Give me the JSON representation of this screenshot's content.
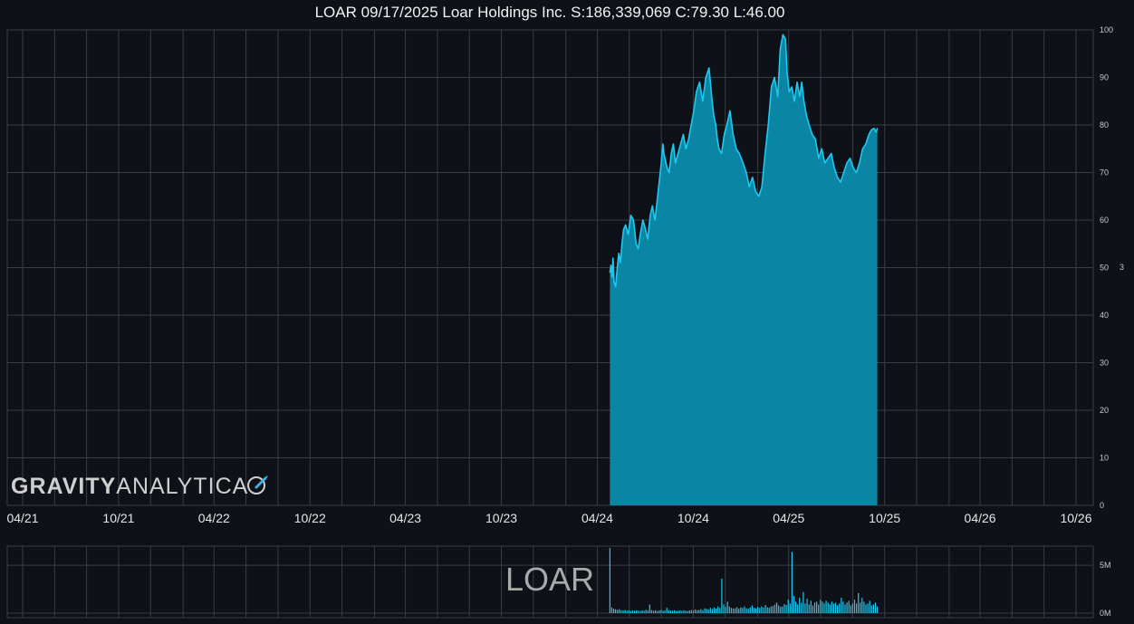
{
  "title": "LOAR 09/17/2025 Loar Holdings Inc. S:186,339,069 C:79.30 L:46.00",
  "logo": {
    "bold": "GRAVITY",
    "light": "ANALYTICA",
    "icon": "rocket-icon"
  },
  "ticker_watermark": "LOAR",
  "y_tag": "3",
  "colors": {
    "background": "#0e1117",
    "grid": "#3a3d44",
    "line": "#1fc8ef",
    "fill": "#0a8fb0"
  },
  "chart_data": [
    {
      "type": "area",
      "title": "LOAR 09/17/2025 Loar Holdings Inc. S:186,339,069 C:79.30 L:46.00",
      "x_tick_labels": [
        "04/21",
        "10/21",
        "04/22",
        "10/22",
        "04/23",
        "10/23",
        "04/24",
        "10/24",
        "04/25",
        "10/25",
        "04/26",
        "10/26"
      ],
      "y_ticks": [
        0,
        10,
        20,
        30,
        40,
        50,
        60,
        70,
        80,
        90,
        100
      ],
      "ylim": [
        0,
        100
      ],
      "grid": true,
      "y_axis_side": "right",
      "x": [
        "2024-04-25",
        "2024-04-27",
        "2024-04-29",
        "2024-05-01",
        "2024-05-03",
        "2024-05-06",
        "2024-05-09",
        "2024-05-12",
        "2024-05-15",
        "2024-05-18",
        "2024-05-21",
        "2024-05-25",
        "2024-05-30",
        "2024-06-04",
        "2024-06-09",
        "2024-06-14",
        "2024-06-18",
        "2024-06-22",
        "2024-06-27",
        "2024-07-02",
        "2024-07-06",
        "2024-07-11",
        "2024-07-15",
        "2024-07-20",
        "2024-07-24",
        "2024-07-28",
        "2024-08-01",
        "2024-08-04",
        "2024-08-06",
        "2024-08-08",
        "2024-08-12",
        "2024-08-16",
        "2024-08-20",
        "2024-08-24",
        "2024-08-28",
        "2024-09-02",
        "2024-09-07",
        "2024-09-12",
        "2024-09-17",
        "2024-09-22",
        "2024-09-27",
        "2024-10-02",
        "2024-10-07",
        "2024-10-13",
        "2024-10-19",
        "2024-10-25",
        "2024-10-31",
        "2024-11-05",
        "2024-11-09",
        "2024-11-13",
        "2024-11-16",
        "2024-11-19",
        "2024-11-24",
        "2024-11-29",
        "2024-12-04",
        "2024-12-10",
        "2024-12-16",
        "2024-12-22",
        "2024-12-28",
        "2025-01-04",
        "2025-01-10",
        "2025-01-16",
        "2025-01-22",
        "2025-01-28",
        "2025-02-03",
        "2025-02-09",
        "2025-02-15",
        "2025-02-21",
        "2025-02-27",
        "2025-03-05",
        "2025-03-11",
        "2025-03-16",
        "2025-03-21",
        "2025-03-26",
        "2025-03-29",
        "2025-04-02",
        "2025-04-07",
        "2025-04-12",
        "2025-04-17",
        "2025-04-22",
        "2025-04-26",
        "2025-04-30",
        "2025-05-05",
        "2025-05-10",
        "2025-05-16",
        "2025-05-22",
        "2025-05-28",
        "2025-06-03",
        "2025-06-09",
        "2025-06-15",
        "2025-06-21",
        "2025-06-27",
        "2025-07-03",
        "2025-07-09",
        "2025-07-15",
        "2025-07-21",
        "2025-07-27",
        "2025-08-02",
        "2025-08-08",
        "2025-08-14",
        "2025-08-20",
        "2025-08-26",
        "2025-09-01",
        "2025-09-06",
        "2025-09-11",
        "2025-09-15",
        "2025-09-17"
      ],
      "series": [
        {
          "values": [
            49,
            50.5,
            48,
            52,
            47,
            46,
            50,
            53,
            51,
            55,
            58,
            59,
            57,
            61,
            60,
            55,
            54,
            57,
            60,
            58,
            56,
            61,
            63,
            60,
            64,
            68,
            72,
            76,
            74,
            73,
            71,
            70,
            74,
            76,
            72,
            74,
            76,
            78,
            75,
            77,
            80,
            83,
            87,
            89,
            85,
            90,
            92,
            86,
            82,
            80,
            77,
            75,
            74,
            78,
            80,
            83,
            78,
            75,
            74,
            72,
            70,
            67,
            69,
            66,
            65,
            67,
            74,
            80,
            88,
            90,
            86,
            96,
            99,
            98,
            91,
            87,
            88,
            85,
            89,
            86,
            89,
            85,
            82,
            80,
            78,
            77,
            73,
            75,
            72,
            73,
            74,
            71,
            69,
            68,
            70,
            72,
            73,
            71,
            70,
            72,
            75,
            76,
            78,
            79,
            79.3,
            78.5,
            79.3
          ]
        }
      ]
    },
    {
      "type": "bar",
      "title": "LOAR",
      "y_tick_labels": [
        "0M",
        "5M"
      ],
      "ylim": [
        0,
        7
      ],
      "grid": true,
      "y_axis_side": "right",
      "x_range": [
        "2024-04-25",
        "2025-09-17"
      ],
      "series": [
        {
          "values": [
            6.8,
            0.6,
            0.45,
            0.4,
            0.35,
            0.42,
            0.3,
            0.28,
            0.34,
            0.25,
            0.3,
            0.22,
            0.28,
            0.24,
            0.3,
            0.26,
            0.22,
            0.3,
            0.25,
            0.35,
            0.28,
            0.9,
            0.32,
            0.26,
            0.3,
            0.22,
            0.28,
            0.35,
            0.25,
            0.28,
            0.55,
            0.3,
            0.26,
            0.24,
            0.3,
            0.22,
            0.26,
            0.28,
            0.24,
            0.3,
            0.26,
            0.22,
            0.28,
            0.32,
            0.26,
            0.38,
            0.3,
            0.34,
            0.42,
            0.3,
            0.5,
            0.45,
            0.38,
            0.55,
            0.42,
            0.6,
            0.48,
            0.7,
            0.55,
            3.6,
            0.9,
            0.65,
            1.2,
            0.7,
            0.55,
            0.48,
            0.5,
            0.62,
            0.45,
            0.6,
            0.55,
            0.7,
            0.5,
            0.45,
            0.6,
            0.8,
            0.55,
            0.5,
            0.65,
            0.55,
            0.7,
            0.6,
            0.85,
            0.62,
            0.55,
            0.7,
            0.75,
            0.9,
            1.1,
            0.8,
            0.65,
            0.7,
            0.95,
            0.85,
            1.4,
            1.0,
            6.4,
            1.8,
            1.2,
            0.9,
            1.6,
            1.1,
            2.2,
            1.0,
            1.5,
            0.9,
            1.3,
            0.8,
            1.1,
            1.2,
            0.9,
            1.4,
            1.2,
            1.0,
            1.3,
            1.1,
            0.9,
            1.2,
            1.0,
            1.1,
            0.8,
            1.0,
            1.6,
            1.2,
            0.9,
            1.1,
            1.3,
            0.8,
            1.0,
            1.4,
            1.0,
            2.1,
            1.1,
            1.6,
            1.2,
            0.9,
            1.0,
            1.3,
            0.8,
            0.9,
            1.1,
            0.7
          ]
        }
      ]
    }
  ]
}
